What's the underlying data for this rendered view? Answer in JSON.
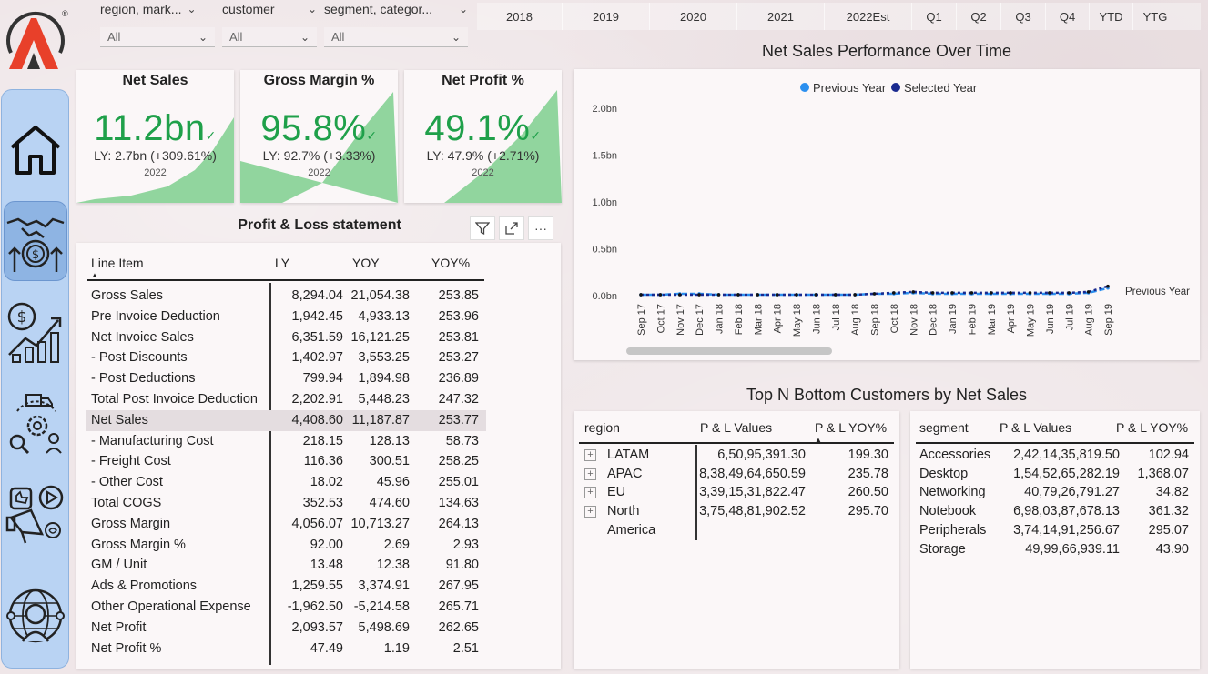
{
  "logo": {
    "icon": "atliq-logo-icon",
    "mark": "®"
  },
  "slicers": [
    {
      "title": "region, mark...",
      "value": "All"
    },
    {
      "title": "customer",
      "value": "All"
    },
    {
      "title": "segment, categor...",
      "value": "All"
    }
  ],
  "periods": [
    "2018",
    "2019",
    "2020",
    "2021",
    "2022Est",
    "Q1",
    "Q2",
    "Q3",
    "Q4",
    "YTD",
    "YTG"
  ],
  "nav": [
    {
      "icon": "home-icon"
    },
    {
      "icon": "handshake-dollar-icon"
    },
    {
      "icon": "dollar-growth-chart-icon"
    },
    {
      "icon": "supply-chain-gear-icon"
    },
    {
      "icon": "marketing-megaphone-icon"
    },
    {
      "icon": "global-support-agent-icon"
    }
  ],
  "kpis": [
    {
      "title": "Net Sales",
      "value": "11.2bn",
      "ly": "LY: 2.7bn (+309.61%)",
      "year": "2022",
      "check": "✓"
    },
    {
      "title": "Gross Margin %",
      "value": "95.8%",
      "ly": "LY: 92.7% (+3.33%)",
      "year": "2022",
      "check": "✓"
    },
    {
      "title": "Net Profit %",
      "value": "49.1%",
      "ly": "LY: 47.9% (+2.71%)",
      "year": "2022",
      "check": "✓"
    }
  ],
  "pl": {
    "title": "Profit & Loss statement",
    "tools": {
      "filter": "filter-icon",
      "focus": "focus-mode-icon",
      "more": "···"
    },
    "headers": {
      "item": "Line Item",
      "ly": "LY",
      "yoy": "YOY",
      "yoyp": "YOY%"
    },
    "rows": [
      {
        "item": "Gross Sales",
        "ly": "8,294.04",
        "yoy": "21,054.38",
        "yoyp": "253.85"
      },
      {
        "item": "Pre Invoice Deduction",
        "ly": "1,942.45",
        "yoy": "4,933.13",
        "yoyp": "253.96"
      },
      {
        "item": "Net Invoice Sales",
        "ly": "6,351.59",
        "yoy": "16,121.25",
        "yoyp": "253.81"
      },
      {
        "item": "- Post Discounts",
        "ly": "1,402.97",
        "yoy": "3,553.25",
        "yoyp": "253.27"
      },
      {
        "item": "- Post Deductions",
        "ly": "799.94",
        "yoy": "1,894.98",
        "yoyp": "236.89"
      },
      {
        "item": "Total Post Invoice Deduction",
        "ly": "2,202.91",
        "yoy": "5,448.23",
        "yoyp": "247.32"
      },
      {
        "item": "Net Sales",
        "ly": "4,408.60",
        "yoy": "11,187.87",
        "yoyp": "253.77",
        "highlight": true
      },
      {
        "item": "- Manufacturing Cost",
        "ly": "218.15",
        "yoy": "128.13",
        "yoyp": "58.73"
      },
      {
        "item": "- Freight Cost",
        "ly": "116.36",
        "yoy": "300.51",
        "yoyp": "258.25"
      },
      {
        "item": "- Other Cost",
        "ly": "18.02",
        "yoy": "45.96",
        "yoyp": "255.01"
      },
      {
        "item": "Total COGS",
        "ly": "352.53",
        "yoy": "474.60",
        "yoyp": "134.63"
      },
      {
        "item": "Gross Margin",
        "ly": "4,056.07",
        "yoy": "10,713.27",
        "yoyp": "264.13"
      },
      {
        "item": "Gross Margin %",
        "ly": "92.00",
        "yoy": "2.69",
        "yoyp": "2.93"
      },
      {
        "item": "GM / Unit",
        "ly": "13.48",
        "yoy": "12.38",
        "yoyp": "91.80"
      },
      {
        "item": "Ads & Promotions",
        "ly": "1,259.55",
        "yoy": "3,374.91",
        "yoyp": "267.95"
      },
      {
        "item": "Other Operational Expense",
        "ly": "-1,962.50",
        "yoy": "-5,214.58",
        "yoyp": "265.71"
      },
      {
        "item": "Net Profit",
        "ly": "2,093.57",
        "yoy": "5,498.69",
        "yoyp": "262.65"
      },
      {
        "item": "Net Profit %",
        "ly": "47.49",
        "yoy": "1.19",
        "yoyp": "2.51"
      }
    ]
  },
  "line_chart": {
    "title": "Net Sales Performance Over Time",
    "legend": [
      {
        "name": "Previous Year",
        "color": "#2b8fef"
      },
      {
        "name": "Selected Year",
        "color": "#1a2a8f"
      }
    ],
    "series_end_label": "Previous Year"
  },
  "chart_data": {
    "type": "line",
    "title": "Net Sales Performance Over Time",
    "xlabel": "",
    "ylabel": "",
    "y_ticks": [
      "2.0bn",
      "1.5bn",
      "1.0bn",
      "0.5bn",
      "0.0bn"
    ],
    "ylim": [
      0,
      2.0
    ],
    "categories": [
      "Sep 17",
      "Oct 17",
      "Nov 17",
      "Dec 17",
      "Jan 18",
      "Feb 18",
      "Mar 18",
      "Apr 18",
      "May 18",
      "Jun 18",
      "Jul 18",
      "Aug 18",
      "Sep 18",
      "Oct 18",
      "Nov 18",
      "Dec 18",
      "Jan 19",
      "Feb 19",
      "Mar 19",
      "Apr 19",
      "May 19",
      "Jun 19",
      "Jul 19",
      "Aug 19",
      "Sep 19"
    ],
    "series": [
      {
        "name": "Previous Year",
        "values": [
          0.01,
          0.01,
          0.02,
          0.02,
          0.01,
          0.01,
          0.01,
          0.01,
          0.01,
          0.01,
          0.01,
          0.01,
          0.02,
          0.02,
          0.03,
          0.02,
          0.02,
          0.02,
          0.02,
          0.02,
          0.02,
          0.02,
          0.02,
          0.03,
          0.08
        ]
      },
      {
        "name": "Selected Year",
        "values": [
          0.01,
          0.01,
          0.01,
          0.01,
          0.01,
          0.01,
          0.01,
          0.01,
          0.01,
          0.01,
          0.01,
          0.01,
          0.02,
          0.03,
          0.04,
          0.03,
          0.03,
          0.03,
          0.03,
          0.03,
          0.03,
          0.03,
          0.03,
          0.04,
          0.1
        ]
      }
    ],
    "legend_position": "top-center",
    "grid": false
  },
  "topn": {
    "title": "Top N Bottom Customers by Net Sales",
    "region_table": {
      "headers": {
        "a": "region",
        "b": "P & L Values",
        "c": "P & L YOY%"
      },
      "rows": [
        {
          "a": "LATAM",
          "b": "6,50,95,391.30",
          "c": "199.30"
        },
        {
          "a": "APAC",
          "b": "8,38,49,64,650.59",
          "c": "235.78"
        },
        {
          "a": "EU",
          "b": "3,39,15,31,822.47",
          "c": "260.50"
        },
        {
          "a": "North",
          "a2": "America",
          "b": "3,75,48,81,902.52",
          "c": "295.70"
        }
      ],
      "expand": "+"
    },
    "segment_table": {
      "headers": {
        "a": "segment",
        "b": "P & L Values",
        "c": "P & L YOY%"
      },
      "rows": [
        {
          "a": "Accessories",
          "b": "2,42,14,35,819.50",
          "c": "102.94"
        },
        {
          "a": "Desktop",
          "b": "1,54,52,65,282.19",
          "c": "1,368.07"
        },
        {
          "a": "Networking",
          "b": "40,79,26,791.27",
          "c": "34.82"
        },
        {
          "a": "Notebook",
          "b": "6,98,03,87,678.13",
          "c": "361.32"
        },
        {
          "a": "Peripherals",
          "b": "3,74,14,91,256.67",
          "c": "295.07"
        },
        {
          "a": "Storage",
          "b": "49,99,66,939.11",
          "c": "43.90"
        }
      ]
    }
  }
}
